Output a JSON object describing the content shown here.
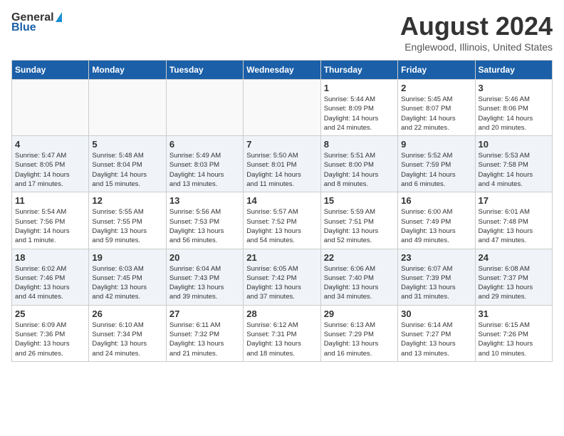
{
  "header": {
    "logo_general": "General",
    "logo_blue": "Blue",
    "month_title": "August 2024",
    "subtitle": "Englewood, Illinois, United States"
  },
  "weekdays": [
    "Sunday",
    "Monday",
    "Tuesday",
    "Wednesday",
    "Thursday",
    "Friday",
    "Saturday"
  ],
  "weeks": [
    [
      {
        "day": "",
        "info": ""
      },
      {
        "day": "",
        "info": ""
      },
      {
        "day": "",
        "info": ""
      },
      {
        "day": "",
        "info": ""
      },
      {
        "day": "1",
        "info": "Sunrise: 5:44 AM\nSunset: 8:09 PM\nDaylight: 14 hours\nand 24 minutes."
      },
      {
        "day": "2",
        "info": "Sunrise: 5:45 AM\nSunset: 8:07 PM\nDaylight: 14 hours\nand 22 minutes."
      },
      {
        "day": "3",
        "info": "Sunrise: 5:46 AM\nSunset: 8:06 PM\nDaylight: 14 hours\nand 20 minutes."
      }
    ],
    [
      {
        "day": "4",
        "info": "Sunrise: 5:47 AM\nSunset: 8:05 PM\nDaylight: 14 hours\nand 17 minutes."
      },
      {
        "day": "5",
        "info": "Sunrise: 5:48 AM\nSunset: 8:04 PM\nDaylight: 14 hours\nand 15 minutes."
      },
      {
        "day": "6",
        "info": "Sunrise: 5:49 AM\nSunset: 8:03 PM\nDaylight: 14 hours\nand 13 minutes."
      },
      {
        "day": "7",
        "info": "Sunrise: 5:50 AM\nSunset: 8:01 PM\nDaylight: 14 hours\nand 11 minutes."
      },
      {
        "day": "8",
        "info": "Sunrise: 5:51 AM\nSunset: 8:00 PM\nDaylight: 14 hours\nand 8 minutes."
      },
      {
        "day": "9",
        "info": "Sunrise: 5:52 AM\nSunset: 7:59 PM\nDaylight: 14 hours\nand 6 minutes."
      },
      {
        "day": "10",
        "info": "Sunrise: 5:53 AM\nSunset: 7:58 PM\nDaylight: 14 hours\nand 4 minutes."
      }
    ],
    [
      {
        "day": "11",
        "info": "Sunrise: 5:54 AM\nSunset: 7:56 PM\nDaylight: 14 hours\nand 1 minute."
      },
      {
        "day": "12",
        "info": "Sunrise: 5:55 AM\nSunset: 7:55 PM\nDaylight: 13 hours\nand 59 minutes."
      },
      {
        "day": "13",
        "info": "Sunrise: 5:56 AM\nSunset: 7:53 PM\nDaylight: 13 hours\nand 56 minutes."
      },
      {
        "day": "14",
        "info": "Sunrise: 5:57 AM\nSunset: 7:52 PM\nDaylight: 13 hours\nand 54 minutes."
      },
      {
        "day": "15",
        "info": "Sunrise: 5:59 AM\nSunset: 7:51 PM\nDaylight: 13 hours\nand 52 minutes."
      },
      {
        "day": "16",
        "info": "Sunrise: 6:00 AM\nSunset: 7:49 PM\nDaylight: 13 hours\nand 49 minutes."
      },
      {
        "day": "17",
        "info": "Sunrise: 6:01 AM\nSunset: 7:48 PM\nDaylight: 13 hours\nand 47 minutes."
      }
    ],
    [
      {
        "day": "18",
        "info": "Sunrise: 6:02 AM\nSunset: 7:46 PM\nDaylight: 13 hours\nand 44 minutes."
      },
      {
        "day": "19",
        "info": "Sunrise: 6:03 AM\nSunset: 7:45 PM\nDaylight: 13 hours\nand 42 minutes."
      },
      {
        "day": "20",
        "info": "Sunrise: 6:04 AM\nSunset: 7:43 PM\nDaylight: 13 hours\nand 39 minutes."
      },
      {
        "day": "21",
        "info": "Sunrise: 6:05 AM\nSunset: 7:42 PM\nDaylight: 13 hours\nand 37 minutes."
      },
      {
        "day": "22",
        "info": "Sunrise: 6:06 AM\nSunset: 7:40 PM\nDaylight: 13 hours\nand 34 minutes."
      },
      {
        "day": "23",
        "info": "Sunrise: 6:07 AM\nSunset: 7:39 PM\nDaylight: 13 hours\nand 31 minutes."
      },
      {
        "day": "24",
        "info": "Sunrise: 6:08 AM\nSunset: 7:37 PM\nDaylight: 13 hours\nand 29 minutes."
      }
    ],
    [
      {
        "day": "25",
        "info": "Sunrise: 6:09 AM\nSunset: 7:36 PM\nDaylight: 13 hours\nand 26 minutes."
      },
      {
        "day": "26",
        "info": "Sunrise: 6:10 AM\nSunset: 7:34 PM\nDaylight: 13 hours\nand 24 minutes."
      },
      {
        "day": "27",
        "info": "Sunrise: 6:11 AM\nSunset: 7:32 PM\nDaylight: 13 hours\nand 21 minutes."
      },
      {
        "day": "28",
        "info": "Sunrise: 6:12 AM\nSunset: 7:31 PM\nDaylight: 13 hours\nand 18 minutes."
      },
      {
        "day": "29",
        "info": "Sunrise: 6:13 AM\nSunset: 7:29 PM\nDaylight: 13 hours\nand 16 minutes."
      },
      {
        "day": "30",
        "info": "Sunrise: 6:14 AM\nSunset: 7:27 PM\nDaylight: 13 hours\nand 13 minutes."
      },
      {
        "day": "31",
        "info": "Sunrise: 6:15 AM\nSunset: 7:26 PM\nDaylight: 13 hours\nand 10 minutes."
      }
    ]
  ]
}
